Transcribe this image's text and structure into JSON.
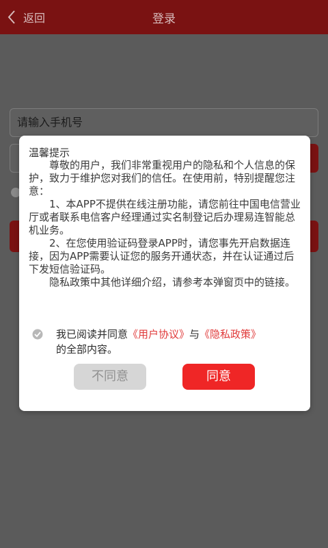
{
  "navbar": {
    "back_label": "返回",
    "title": "登录",
    "back_icon": "chevron-left-icon"
  },
  "form": {
    "phone_placeholder": "请输入手机号"
  },
  "dialog": {
    "title": "温馨提示",
    "paragraphs": [
      "尊敬的用户，我们非常重视用户的隐私和个人信息的保护，致力于维护您对我们的信任。在使用前，特别提醒您注意：",
      "1、本APP不提供在线注册功能，请您前往中国电信营业厅或者联系电信客户经理通过实名制登记后办理易连智能总机业务。",
      "2、在您使用验证码登录APP时，请您事先开启数据连接，因为APP需要认证您的服务开通状态，并在认证通过后下发短信验证码。",
      "隐私政策中其他详细介绍，请参考本弹窗页中的链接。"
    ],
    "agree_prefix": "我已阅读并同意",
    "user_agreement": "《用户协议》",
    "and": "与",
    "privacy_policy": "《隐私政策》",
    "agree_suffix": "的全部内容。",
    "disagree_label": "不同意",
    "agree_label": "同意",
    "check_icon": "checkmark-circle-icon"
  },
  "colors": {
    "brand_red": "#ef2626",
    "link_red": "#e03a3a",
    "overlay": "#5b5b5b",
    "disabled_gray": "#d6d6d6"
  }
}
